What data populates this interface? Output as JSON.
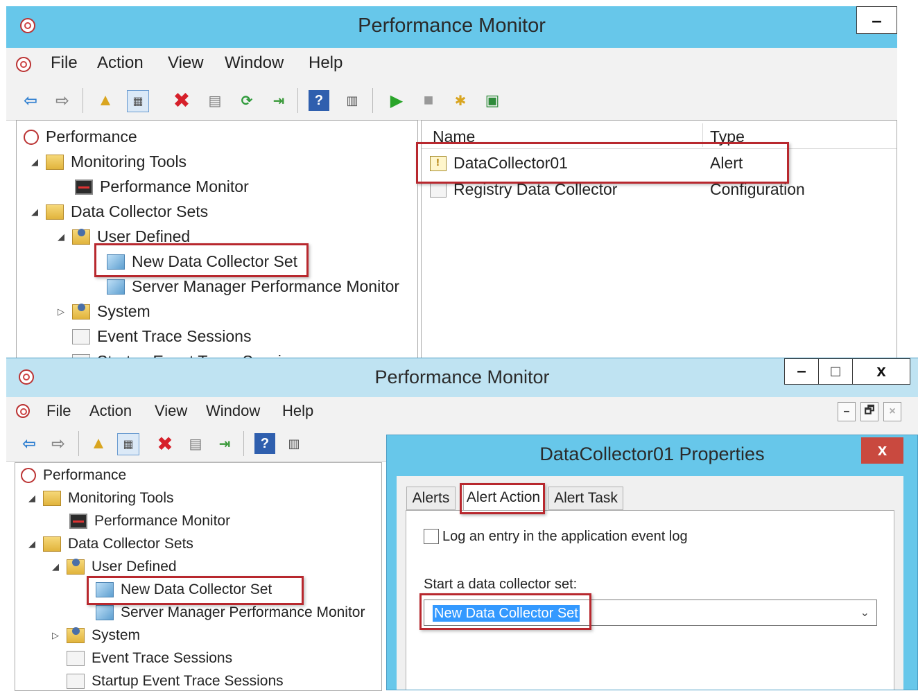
{
  "top_window": {
    "title": "Performance Monitor",
    "minimize": "–",
    "menu": [
      "File",
      "Action",
      "View",
      "Window",
      "Help"
    ],
    "tree": {
      "root": "Performance",
      "monitoring_tools": "Monitoring Tools",
      "performance_monitor": "Performance Monitor",
      "data_collector_sets": "Data Collector Sets",
      "user_defined": "User Defined",
      "new_data_collector_set": "New Data Collector Set",
      "server_manager_pm": "Server Manager Performance Monitor",
      "system": "System",
      "event_trace_sessions": "Event Trace Sessions",
      "startup_event_trace_sessions": "Startup Event Trace Sessions"
    },
    "list": {
      "headers": {
        "name": "Name",
        "type": "Type"
      },
      "rows": [
        {
          "name": "DataCollector01",
          "type": "Alert"
        },
        {
          "name": "Registry Data Collector",
          "type": "Configuration"
        }
      ]
    }
  },
  "bottom_window": {
    "title": "Performance Monitor",
    "controls": {
      "minimize": "–",
      "maximize": "□",
      "close": "x"
    },
    "mdi_controls": {
      "minimize": "–",
      "restore": "🗗",
      "close": "×"
    },
    "menu": [
      "File",
      "Action",
      "View",
      "Window",
      "Help"
    ],
    "tree": {
      "root": "Performance",
      "monitoring_tools": "Monitoring Tools",
      "performance_monitor": "Performance Monitor",
      "data_collector_sets": "Data Collector Sets",
      "user_defined": "User Defined",
      "new_data_collector_set": "New Data Collector Set",
      "server_manager_pm": "Server Manager Performance Monitor",
      "system": "System",
      "event_trace_sessions": "Event Trace Sessions",
      "startup_event_trace_sessions": "Startup Event Trace Sessions"
    }
  },
  "dialog": {
    "title": "DataCollector01 Properties",
    "close": "x",
    "tabs": [
      "Alerts",
      "Alert Action",
      "Alert Task"
    ],
    "active_tab": "Alert Action",
    "log_checkbox_label": "Log an entry in the application event log",
    "log_checked": false,
    "start_label": "Start a data collector set:",
    "start_value": "New Data Collector Set"
  },
  "icons": {
    "back": "back-arrow-icon",
    "forward": "forward-arrow-icon",
    "up": "up-folder-icon",
    "show_hide": "show-hide-tree-icon",
    "delete": "delete-icon",
    "properties": "properties-icon",
    "refresh": "refresh-icon",
    "export": "export-icon",
    "help": "help-icon",
    "action_pane": "action-pane-icon",
    "start": "start-icon",
    "stop": "stop-icon",
    "new": "new-icon",
    "save": "save-template-icon"
  },
  "colors": {
    "titlebar": "#67c7ea",
    "highlight_box": "#b8282e",
    "selection": "#3399ff",
    "dialog_close": "#c9493f"
  }
}
